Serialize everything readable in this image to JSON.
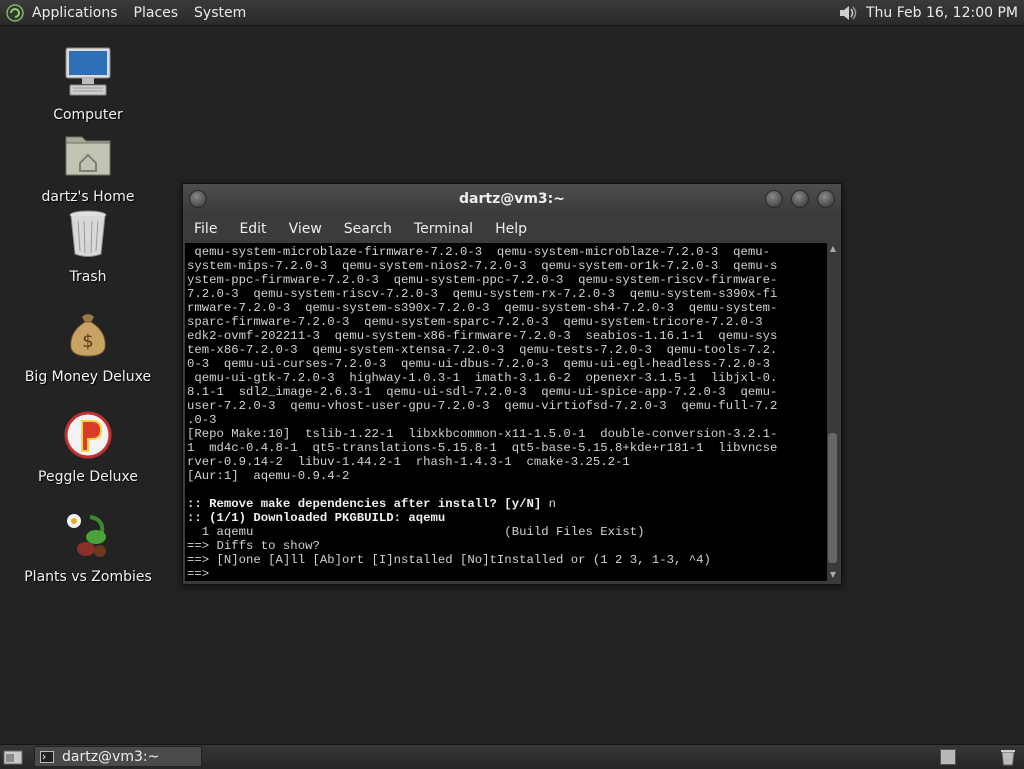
{
  "top_panel": {
    "menus": [
      "Applications",
      "Places",
      "System"
    ],
    "clock": "Thu Feb 16, 12:00 PM",
    "icons": [
      "distro-logo-icon",
      "volume-icon"
    ]
  },
  "desktop_icons": [
    {
      "label": "Computer",
      "icon": "computer-icon"
    },
    {
      "label": "dartz's Home",
      "icon": "home-folder-icon"
    },
    {
      "label": "Trash",
      "icon": "trash-icon"
    },
    {
      "label": "Big Money Deluxe",
      "icon": "money-bag-icon"
    },
    {
      "label": "Peggle Deluxe",
      "icon": "peggle-icon"
    },
    {
      "label": "Plants vs Zombies",
      "icon": "plants-vs-zombies-icon"
    }
  ],
  "terminal": {
    "title": "dartz@vm3:~",
    "menu": [
      "File",
      "Edit",
      "View",
      "Search",
      "Terminal",
      "Help"
    ],
    "lines": [
      {
        "text": " qemu-system-microblaze-firmware-7.2.0-3  qemu-system-microblaze-7.2.0-3  qemu-",
        "bold": false
      },
      {
        "text": "system-mips-7.2.0-3  qemu-system-nios2-7.2.0-3  qemu-system-or1k-7.2.0-3  qemu-s",
        "bold": false
      },
      {
        "text": "ystem-ppc-firmware-7.2.0-3  qemu-system-ppc-7.2.0-3  qemu-system-riscv-firmware-",
        "bold": false
      },
      {
        "text": "7.2.0-3  qemu-system-riscv-7.2.0-3  qemu-system-rx-7.2.0-3  qemu-system-s390x-fi",
        "bold": false
      },
      {
        "text": "rmware-7.2.0-3  qemu-system-s390x-7.2.0-3  qemu-system-sh4-7.2.0-3  qemu-system-",
        "bold": false
      },
      {
        "text": "sparc-firmware-7.2.0-3  qemu-system-sparc-7.2.0-3  qemu-system-tricore-7.2.0-3",
        "bold": false
      },
      {
        "text": "edk2-ovmf-202211-3  qemu-system-x86-firmware-7.2.0-3  seabios-1.16.1-1  qemu-sys",
        "bold": false
      },
      {
        "text": "tem-x86-7.2.0-3  qemu-system-xtensa-7.2.0-3  qemu-tests-7.2.0-3  qemu-tools-7.2.",
        "bold": false
      },
      {
        "text": "0-3  qemu-ui-curses-7.2.0-3  qemu-ui-dbus-7.2.0-3  qemu-ui-egl-headless-7.2.0-3",
        "bold": false
      },
      {
        "text": " qemu-ui-gtk-7.2.0-3  highway-1.0.3-1  imath-3.1.6-2  openexr-3.1.5-1  libjxl-0.",
        "bold": false
      },
      {
        "text": "8.1-1  sdl2_image-2.6.3-1  qemu-ui-sdl-7.2.0-3  qemu-ui-spice-app-7.2.0-3  qemu-",
        "bold": false
      },
      {
        "text": "user-7.2.0-3  qemu-vhost-user-gpu-7.2.0-3  qemu-virtiofsd-7.2.0-3  qemu-full-7.2",
        "bold": false
      },
      {
        "text": ".0-3",
        "bold": false
      },
      {
        "text": "[Repo Make:10]  tslib-1.22-1  libxkbcommon-x11-1.5.0-1  double-conversion-3.2.1-",
        "bold": false
      },
      {
        "text": "1  md4c-0.4.8-1  qt5-translations-5.15.8-1  qt5-base-5.15.8+kde+r181-1  libvncse",
        "bold": false
      },
      {
        "text": "rver-0.9.14-2  libuv-1.44.2-1  rhash-1.4.3-1  cmake-3.25.2-1",
        "bold": false
      },
      {
        "text": "[Aur:1]  aqemu-0.9.4-2",
        "bold": false
      },
      {
        "text": "",
        "bold": false
      },
      {
        "text": ":: Remove make dependencies after install? [y/N] ",
        "bold": true,
        "suffix": "n"
      },
      {
        "text": ":: (1/1) Downloaded PKGBUILD: aqemu",
        "bold": true
      },
      {
        "text": "  1 aqemu                                  (Build Files Exist)",
        "bold": false
      },
      {
        "text": "==> Diffs to show?",
        "bold": false
      },
      {
        "text": "==> [N]one [A]ll [Ab]ort [I]nstalled [No]tInstalled or (1 2 3, 1-3, ^4)",
        "bold": false
      },
      {
        "text": "==>",
        "bold": false
      }
    ]
  },
  "taskbar": {
    "task_label": "dartz@vm3:~",
    "icons": [
      "show-desktop-icon",
      "terminal-icon",
      "workspace-switcher-icon",
      "trash-applet-icon"
    ]
  }
}
